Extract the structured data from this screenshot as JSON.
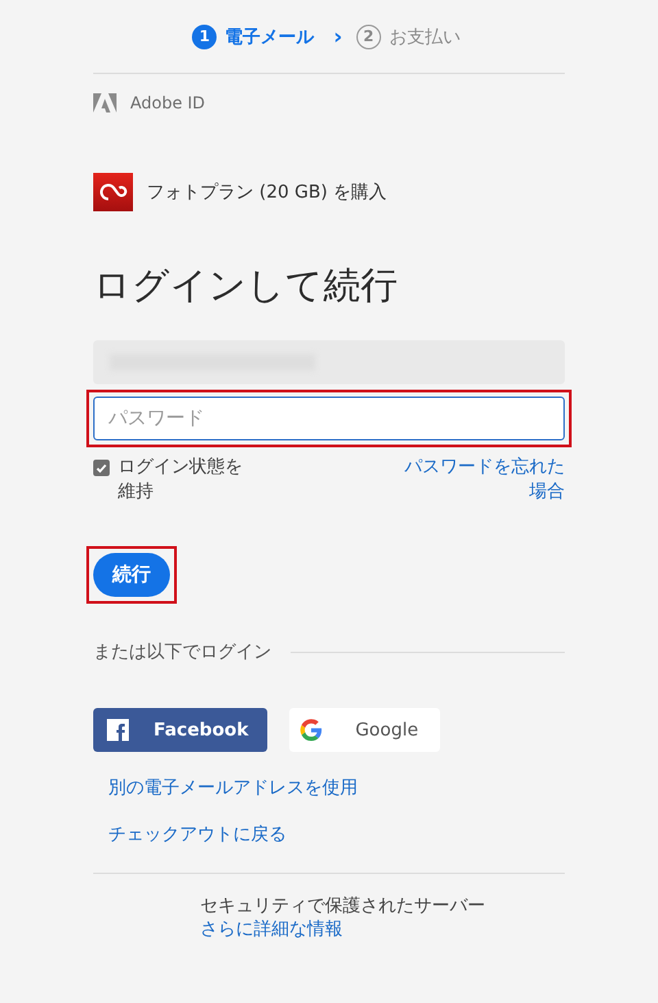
{
  "steps": [
    {
      "number": "1",
      "label": "電子メール",
      "selected": true
    },
    {
      "number": "2",
      "label": "お支払い",
      "selected": false
    }
  ],
  "step_separator": "›",
  "brand": {
    "label": "Adobe ID"
  },
  "product": {
    "label": "フォトプラン (20 GB) を購入"
  },
  "heading": "ログインして続行",
  "email_field": {
    "kind": "blurred"
  },
  "password_field": {
    "placeholder": "パスワード",
    "highlighted": true
  },
  "remember": {
    "label": "ログイン状態を維持",
    "checked": true
  },
  "forgot_link": "パスワードを忘れた場合",
  "continue_button": {
    "label": "続行",
    "highlighted": true
  },
  "alt_login": {
    "label": "または以下でログイン"
  },
  "social_buttons": [
    {
      "kind": "facebook",
      "label": "Facebook"
    },
    {
      "kind": "google",
      "label": "Google"
    }
  ],
  "links": [
    "別の電子メールアドレスを使用",
    "チェックアウトに戻る"
  ],
  "footer": {
    "text": "セキュリティで保護されたサーバー",
    "link": "さらに詳細な情報"
  }
}
